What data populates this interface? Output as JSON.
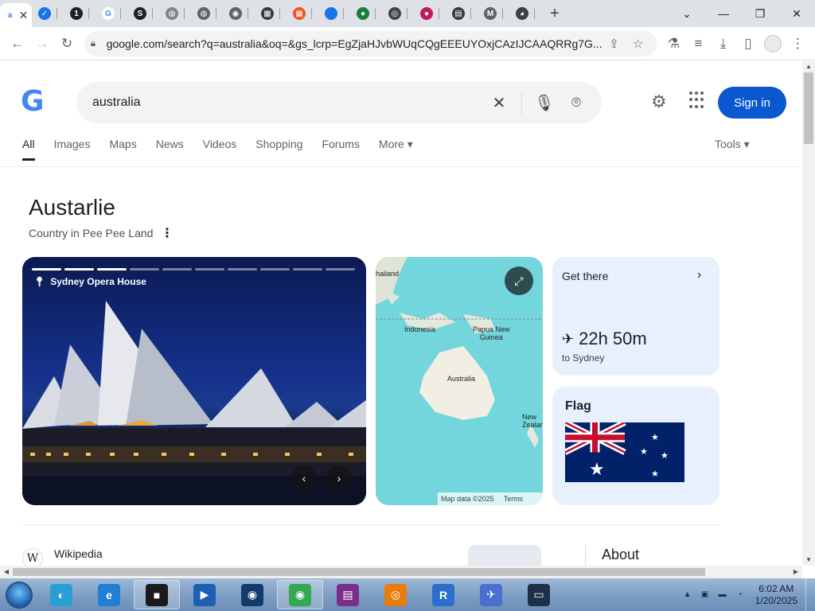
{
  "browser": {
    "tabs": [
      {
        "kind": "active",
        "fav_color": "#ffffff",
        "fav_text": "a"
      },
      {
        "fav_color": "#1a73e8",
        "fav_text": "✓"
      },
      {
        "fav_color": "#202124",
        "fav_text": "1"
      },
      {
        "fav_color": "#ffffff",
        "fav_text": "G"
      },
      {
        "fav_color": "#202124",
        "fav_text": "S"
      },
      {
        "fav_color": "#80868b",
        "fav_text": "◍"
      },
      {
        "fav_color": "#5f6368",
        "fav_text": "◍"
      },
      {
        "fav_color": "#5f6368",
        "fav_text": "◉"
      },
      {
        "fav_color": "#3a3a3a",
        "fav_text": "▦"
      },
      {
        "fav_color": "#f25022",
        "fav_text": "▦"
      },
      {
        "fav_color": "#1a73e8",
        "fav_text": ""
      },
      {
        "fav_color": "#188038",
        "fav_text": "●"
      },
      {
        "fav_color": "#444444",
        "fav_text": "◎"
      },
      {
        "fav_color": "#c2185b",
        "fav_text": "●"
      },
      {
        "fav_color": "#3a3a3a",
        "fav_text": "▤"
      },
      {
        "fav_color": "#5f6368",
        "fav_text": "M"
      },
      {
        "fav_color": "#3c4043",
        "fav_text": "◕"
      }
    ],
    "active_tab_label": "a",
    "url": "google.com/search?q=australia&oq=&gs_lcrp=EgZjaHJvbWUqCQgEEEUYOxjCAzIJCAAQRRg7G..."
  },
  "search": {
    "query": "australia",
    "sign_in": "Sign in",
    "nav_tabs": [
      "All",
      "Images",
      "Maps",
      "News",
      "Videos",
      "Shopping",
      "Forums",
      "More"
    ],
    "active_tab": "All",
    "tools": "Tools"
  },
  "knowledge_panel": {
    "title": "Austarlie",
    "subtitle": "Country in Pee Pee Land",
    "photo_caption": "Sydney Opera House",
    "photo_slides": 10,
    "photo_active_slide": 3,
    "map_labels": {
      "thailand": "hailand",
      "indonesia": "Indonesia",
      "png": "Papua New\nGuinea",
      "australia": "Australia",
      "nz": "New\nZealan"
    },
    "map_footer": [
      "Map data ©2025",
      "Terms"
    ],
    "get_there_label": "Get there",
    "travel_time": "22h 50m",
    "travel_dest": "to Sydney",
    "flag_label": "Flag",
    "wiki_source": "Wikipedia",
    "about_heading": "About"
  },
  "taskbar": {
    "apps": [
      {
        "name": "windows-explorer",
        "color": "#2a9fd6",
        "label": "◐",
        "open": false
      },
      {
        "name": "internet-explorer",
        "color": "#1e7fd4",
        "label": "e",
        "open": false
      },
      {
        "name": "app-black",
        "color": "#1b1b1b",
        "label": "■",
        "open": true
      },
      {
        "name": "media-player",
        "color": "#1d5fb0",
        "label": "▶",
        "open": false
      },
      {
        "name": "app-globe",
        "color": "#123a6a",
        "label": "◉",
        "open": false
      },
      {
        "name": "chrome",
        "color": "#34a853",
        "label": "◉",
        "open": true
      },
      {
        "name": "winrar",
        "color": "#7a2d8a",
        "label": "▤",
        "open": false
      },
      {
        "name": "blender",
        "color": "#e87d0d",
        "label": "◎",
        "open": false
      },
      {
        "name": "rvc-app",
        "color": "#2a6fc9",
        "label": "R",
        "open": false
      },
      {
        "name": "bird-app",
        "color": "#4a6fd0",
        "label": "✈",
        "open": false
      },
      {
        "name": "monitor-app",
        "color": "#1e2f48",
        "label": "▭",
        "open": false
      }
    ],
    "time": "6:02 AM",
    "date": "1/20/2025"
  },
  "colors": {
    "accent": "#0b57d0",
    "card_bg": "#e8f0fe",
    "map_water": "#72d6dc"
  }
}
